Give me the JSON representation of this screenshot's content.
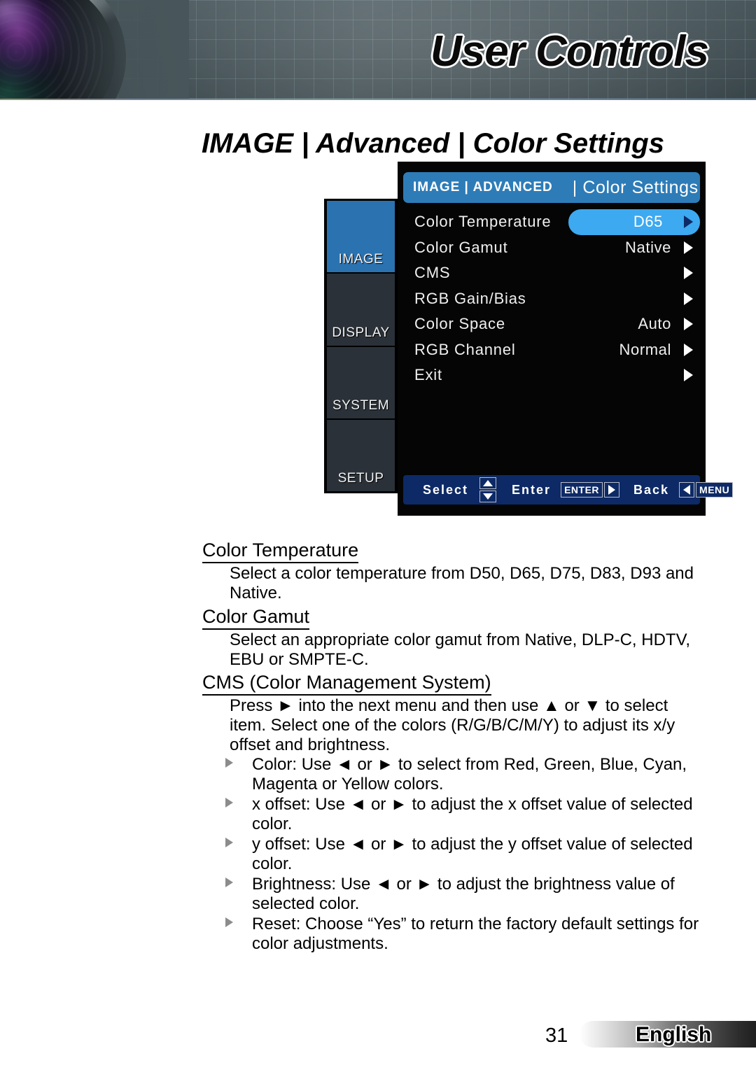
{
  "header": {
    "title": "User Controls",
    "lens_icon": "projector-lens-photo"
  },
  "page": {
    "title": "IMAGE | Advanced | Color Settings"
  },
  "osd": {
    "header": {
      "breadcrumb": "IMAGE | ADVANCED",
      "title": "| Color Settings"
    },
    "tabs": [
      {
        "label": "IMAGE",
        "active": true
      },
      {
        "label": "DISPLAY",
        "active": false
      },
      {
        "label": "SYSTEM",
        "active": false
      },
      {
        "label": "SETUP",
        "active": false
      }
    ],
    "rows": [
      {
        "label": "Color Temperature",
        "value": "D65",
        "selected": true
      },
      {
        "label": "Color Gamut",
        "value": "Native",
        "selected": false
      },
      {
        "label": "CMS",
        "value": "",
        "selected": false
      },
      {
        "label": "RGB Gain/Bias",
        "value": "",
        "selected": false
      },
      {
        "label": "Color Space",
        "value": "Auto",
        "selected": false
      },
      {
        "label": "RGB Channel",
        "value": "Normal",
        "selected": false
      },
      {
        "label": "Exit",
        "value": "",
        "selected": false
      }
    ],
    "footer": {
      "select_label": "Select",
      "enter_label": "Enter",
      "enter_key": "ENTER",
      "back_label": "Back",
      "menu_key": "MENU"
    },
    "colors": {
      "accent_header": "#2d7cb8",
      "accent_highlight": "#3ca9f0",
      "tab_active": "#2b72b0",
      "tab_inactive": "#2a3138",
      "footer_bar": "#0d2a66",
      "panel_bg": "#050505"
    }
  },
  "sections": [
    {
      "heading": "Color Temperature",
      "paragraphs": [
        "Select a color temperature from D50, D65, D75, D83, D93 and Native."
      ],
      "bullets": []
    },
    {
      "heading": "Color Gamut",
      "paragraphs": [
        "Select an appropriate color gamut from Native, DLP-C, HDTV, EBU or SMPTE-C."
      ],
      "bullets": []
    },
    {
      "heading": "CMS (Color Management System)",
      "paragraphs": [
        "Press ► into the next menu and then use ▲ or ▼ to select item. Select one of the colors (R/G/B/C/M/Y) to adjust its x/y offset and brightness."
      ],
      "bullets": [
        "Color: Use ◄ or ► to select from Red, Green, Blue, Cyan, Magenta or Yellow colors.",
        "x offset: Use ◄ or ► to adjust the x offset value of selected color.",
        "y offset: Use ◄ or ► to adjust the y offset value of selected color.",
        "Brightness: Use ◄ or ► to adjust the brightness value of selected color.",
        "Reset: Choose “Yes” to return the factory default settings for color adjustments."
      ]
    }
  ],
  "footer": {
    "page_number": "31",
    "language": "English"
  }
}
